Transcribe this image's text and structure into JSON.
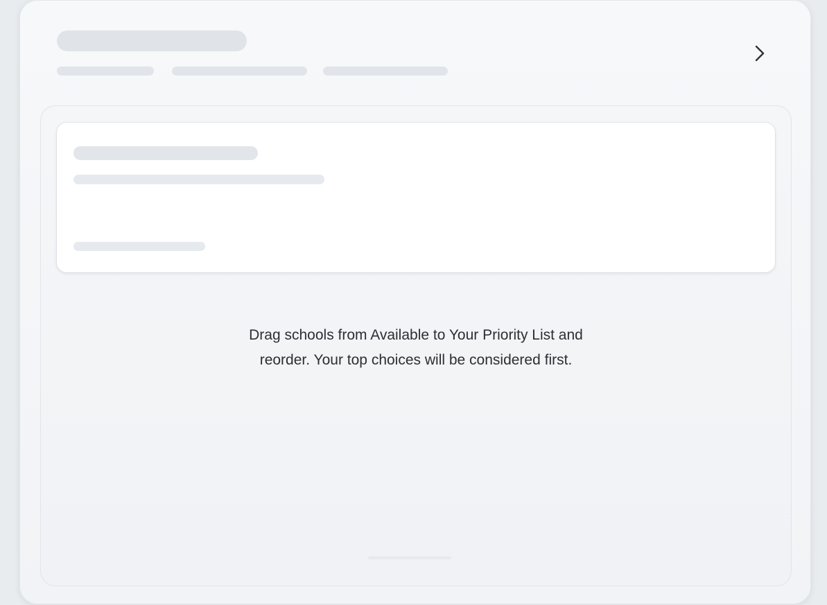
{
  "header": {
    "next_icon": "chevron-right-icon"
  },
  "priority_list": {
    "instructions_line1": "Drag schools from Available to Your Priority List and",
    "instructions_line2": "reorder. Your top choices will be considered first."
  },
  "colors": {
    "background": "#e9ecef",
    "card": "#f5f7f9",
    "skeleton": "#e1e5ea",
    "text": "#2b2f33"
  }
}
